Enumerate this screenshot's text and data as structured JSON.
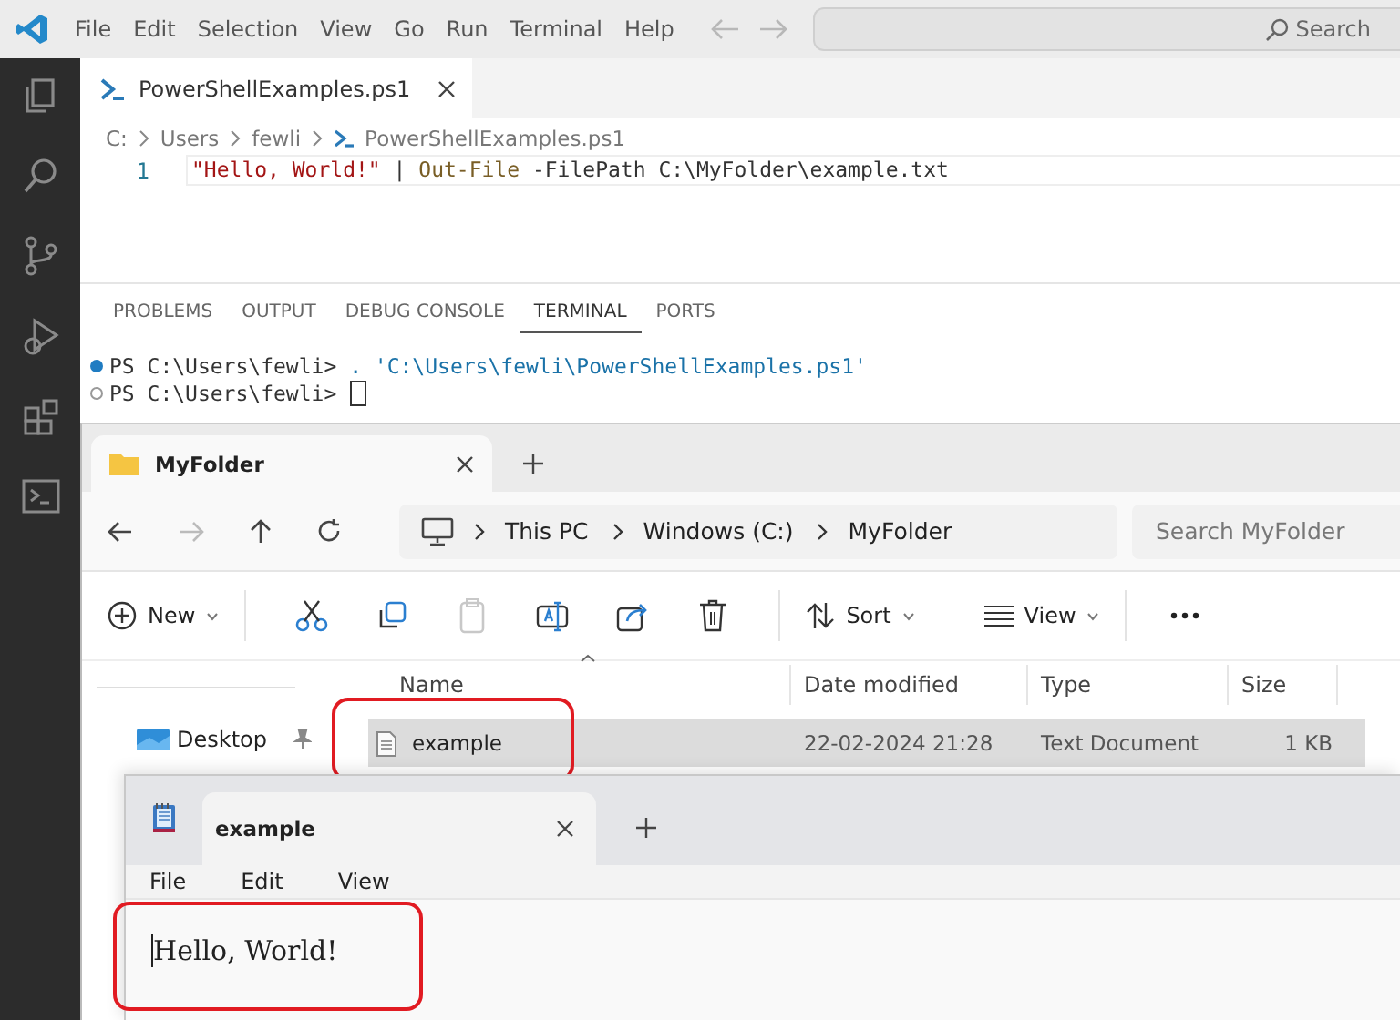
{
  "vscode": {
    "menu": [
      "File",
      "Edit",
      "Selection",
      "View",
      "Go",
      "Run",
      "Terminal",
      "Help"
    ],
    "search": {
      "placeholder": "Search"
    },
    "tabs": [
      {
        "label": "PowerShellExamples.ps1",
        "selected": true
      }
    ],
    "breadcrumb": [
      "C:",
      "Users",
      "fewli",
      "PowerShellExamples.ps1"
    ],
    "code_lines": [
      {
        "number": "1",
        "tokens": [
          {
            "kind": "string",
            "text": "\"Hello, World!\""
          },
          {
            "kind": "operator",
            "text": " | "
          },
          {
            "kind": "command",
            "text": "Out-File"
          },
          {
            "kind": "plain",
            "text": " -FilePath C:\\MyFolder\\example.txt"
          }
        ]
      }
    ],
    "panel_tabs": [
      {
        "label": "PROBLEMS",
        "selected": false
      },
      {
        "label": "OUTPUT",
        "selected": false
      },
      {
        "label": "DEBUG CONSOLE",
        "selected": false
      },
      {
        "label": "TERMINAL",
        "selected": true
      },
      {
        "label": "PORTS",
        "selected": false
      }
    ],
    "terminal_lines": [
      {
        "prompt": "PS C:\\Users\\fewli>",
        "command": ". 'C:\\Users\\fewli\\PowerShellExamples.ps1'",
        "finished": true
      },
      {
        "prompt": "PS C:\\Users\\fewli>",
        "finished": false,
        "cursor": true
      }
    ]
  },
  "explorer": {
    "tab": {
      "label": "MyFolder",
      "selected": true
    },
    "path": [
      "This PC",
      "Windows (C:)",
      "MyFolder"
    ],
    "search": {
      "placeholder": "Search MyFolder"
    },
    "toolbar": {
      "new_label": "New",
      "sort_label": "Sort",
      "view_label": "View",
      "paste_disabled": true
    },
    "sidebar": [
      {
        "label": "Desktop",
        "pinned": true
      }
    ],
    "columns": [
      {
        "label": "Name",
        "sorted": true
      },
      {
        "label": "Date modified",
        "sorted": false
      },
      {
        "label": "Type",
        "sorted": false
      },
      {
        "label": "Size",
        "sorted": false
      }
    ],
    "rows": [
      {
        "name": "example",
        "date": "22-02-2024 21:28",
        "type": "Text Document",
        "size": "1 KB",
        "selected": true,
        "highlighted": true
      }
    ]
  },
  "notepad": {
    "tab": {
      "label": "example",
      "selected": true
    },
    "menu": [
      "File",
      "Edit",
      "View"
    ],
    "text": "Hello, World!",
    "text_highlighted": true
  }
}
